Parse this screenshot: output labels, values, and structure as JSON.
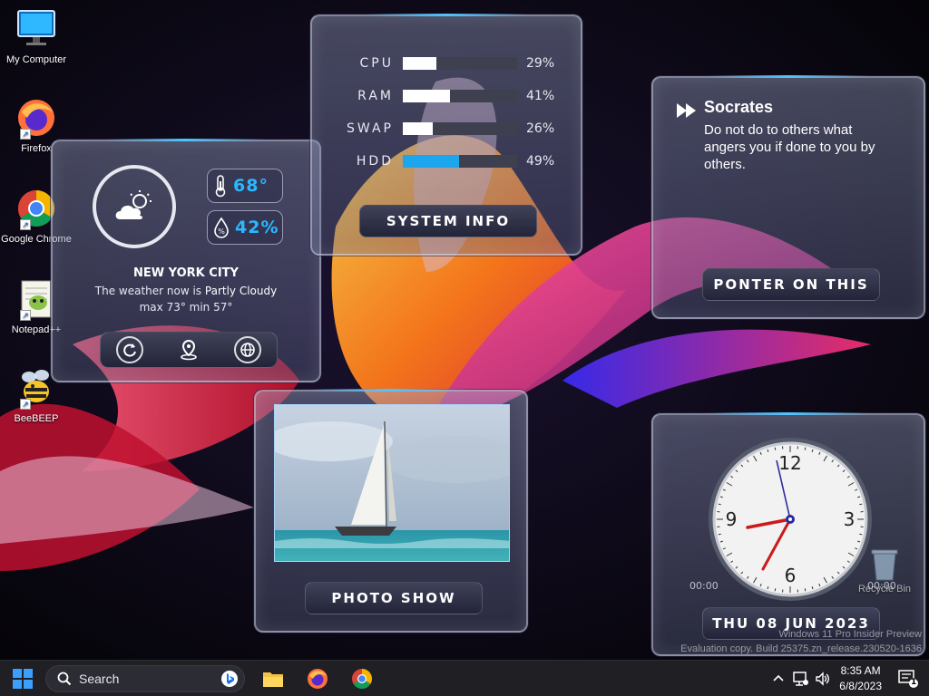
{
  "desktop_icons": [
    {
      "label": "My Computer",
      "icon": "monitor-icon"
    },
    {
      "label": "Firefox",
      "icon": "firefox-icon"
    },
    {
      "label": "Google Chrome",
      "icon": "chrome-icon"
    },
    {
      "label": "Notepad++",
      "icon": "notepad-plus-plus-icon"
    },
    {
      "label": "BeeBEEP",
      "icon": "bee-icon"
    },
    {
      "label": "Recycle Bin",
      "icon": "recycle-bin-icon"
    }
  ],
  "weather": {
    "temperature": "68°",
    "humidity": "42%",
    "city": "NEW YORK CITY",
    "condition_prefix": "The weather now is",
    "condition": "Partly Cloudy",
    "minmax": "max 73° min 57°",
    "icon": "partly-cloudy-day-icon",
    "actions": [
      "refresh-icon",
      "location-pin-icon",
      "globe-icon"
    ]
  },
  "system_info": {
    "meters": [
      {
        "label": "CPU",
        "value": 29,
        "display": "29%",
        "color": "#ffffff"
      },
      {
        "label": "RAM",
        "value": 41,
        "display": "41%",
        "color": "#ffffff"
      },
      {
        "label": "SWAP",
        "value": 26,
        "display": "26%",
        "color": "#ffffff"
      },
      {
        "label": "HDD",
        "value": 49,
        "display": "49%",
        "color": "#1ba6ee"
      }
    ],
    "button_label": "SYSTEM INFO"
  },
  "quote": {
    "author": "Socrates",
    "text": "Do not do to others what angers you if done to you by others.",
    "button_label": "PONTER ON THIS"
  },
  "photo": {
    "button_label": "PHOTO SHOW"
  },
  "clock": {
    "numbers": [
      "12",
      "3",
      "6",
      "9"
    ],
    "left_time": "00:00",
    "right_time": "00:00",
    "date_label": "THU 08 JUN 2023"
  },
  "watermark": {
    "line1": "Windows 11 Pro Insider Preview",
    "line2": "Evaluation copy. Build 25375.zn_release.230520-1636"
  },
  "taskbar": {
    "search_placeholder": "Search",
    "time": "8:35 AM",
    "date": "6/8/2023",
    "notification_count": "1"
  },
  "colors": {
    "accent": "#2ab8ff",
    "panel_glow": "#4fc3ff",
    "taskbar": "#1f1f24"
  }
}
